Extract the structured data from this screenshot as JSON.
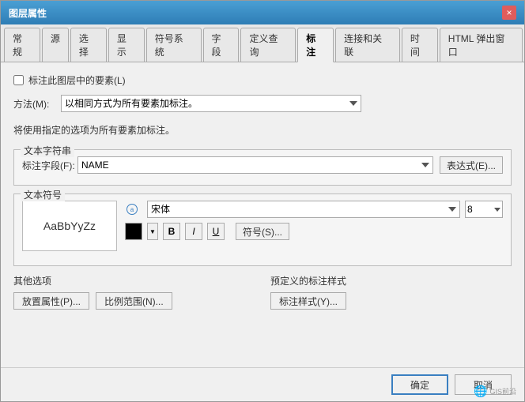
{
  "window": {
    "title": "图层属性",
    "close_label": "×"
  },
  "tabs": [
    {
      "label": "常规",
      "active": false
    },
    {
      "label": "源",
      "active": false
    },
    {
      "label": "选择",
      "active": false
    },
    {
      "label": "显示",
      "active": false
    },
    {
      "label": "符号系统",
      "active": false
    },
    {
      "label": "字段",
      "active": false
    },
    {
      "label": "定义查询",
      "active": false
    },
    {
      "label": "标注",
      "active": true
    },
    {
      "label": "连接和关联",
      "active": false
    },
    {
      "label": "时间",
      "active": false
    },
    {
      "label": "HTML 弹出窗口",
      "active": false
    }
  ],
  "content": {
    "checkbox_label": "标注此图层中的要素(L)",
    "method_label": "方法(M):",
    "method_value": "以相同方式为所有要素加标注。",
    "info_text": "将使用指定的选项为所有要素加标注。",
    "text_string_section": "文本字符串",
    "label_field_label": "标注字段(F):",
    "label_field_value": "NAME",
    "expression_btn": "表达式(E)...",
    "text_symbol_section": "文本符号",
    "preview_text": "AaBbYyZz",
    "font_name": "宋体",
    "font_size": "8",
    "bold_label": "B",
    "italic_label": "I",
    "underline_label": "U",
    "symbol_btn": "符号(S)...",
    "other_options_section": "其他选项",
    "predefined_section": "预定义的标注样式",
    "placement_btn": "放置属性(P)...",
    "scale_btn": "比例范围(N)...",
    "style_btn": "标注样式(Y)...",
    "ok_btn": "确定",
    "cancel_btn": "取消",
    "watermark": "GIS前沿"
  }
}
